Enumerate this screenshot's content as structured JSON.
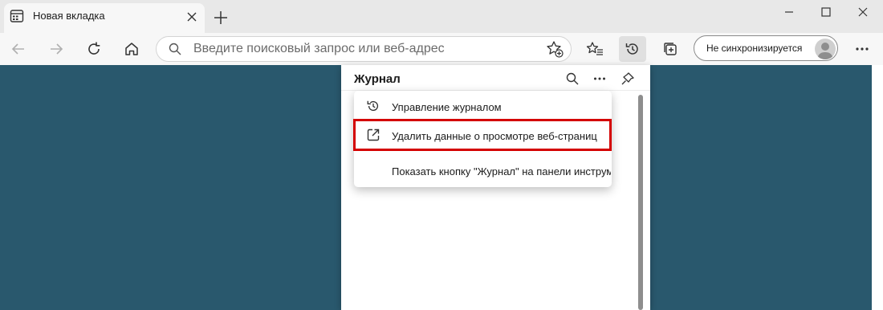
{
  "tab": {
    "title": "Новая вкладка",
    "icon": "new-tab-page-icon"
  },
  "window_controls": [
    "minimize-icon",
    "maximize-icon",
    "close-icon"
  ],
  "toolbar": {
    "address_placeholder": "Введите поисковый запрос или веб-адрес",
    "sync_label": "Не синхронизируется"
  },
  "history_panel": {
    "title": "Журнал",
    "menu": [
      {
        "label": "Управление журналом",
        "icon": "history-icon"
      },
      {
        "label": "Удалить данные о просмотре веб-страниц",
        "icon": "open-external-icon",
        "highlighted": true
      },
      {
        "label": "Показать кнопку \"Журнал\" на панели инструм",
        "icon": ""
      }
    ]
  },
  "colors": {
    "page_background": "#29586d",
    "highlight_border": "#d40000",
    "tabstrip": "#e8e8e8",
    "toolbar": "#f7f7f7"
  }
}
